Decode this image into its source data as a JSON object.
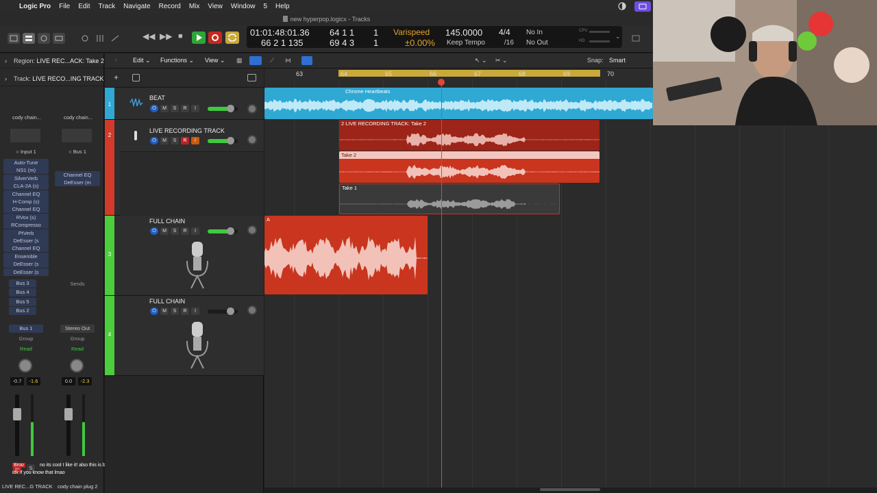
{
  "menubar": {
    "apple": "",
    "app_name": "Logic Pro",
    "items": [
      "File",
      "Edit",
      "Track",
      "Navigate",
      "Record",
      "Mix",
      "View",
      "Window",
      "5",
      "Help"
    ]
  },
  "window": {
    "title": "new hyperpop.logicx - Tracks"
  },
  "lcd": {
    "time": "01:01:48:01.36",
    "bars_top": "64  1  1",
    "sub_top": "1",
    "bars_bottom": "66  2  1  135",
    "bars_bottom2": "69  4  3",
    "sub_bottom": "1",
    "varispeed_label": "Varispeed",
    "varispeed_value": "±0.00%",
    "tempo": "145.0000",
    "tempo_mode": "Keep Tempo",
    "sig_top": "4/4",
    "sig_bottom": "/16",
    "in": "No In",
    "out": "No Out",
    "cpu": "CPU",
    "hd": "HD"
  },
  "inspector": {
    "region_label": "Region:",
    "region_value": "LIVE REC...ACK: Take 2",
    "track_label": "Track:",
    "track_value": "LIVE RECO...ING TRACK",
    "strip1": {
      "setting": "cody chain...",
      "input": "Input 1",
      "plugins": [
        "Auto-Tune",
        "NS1 (m)",
        "SilverVerb",
        "CLA-2A (s)",
        "Channel EQ",
        "H-Comp (s)",
        "Channel EQ",
        "RVox (s)",
        "RCompresso",
        "PtVerb",
        "DeEsser (s",
        "Channel EQ",
        "Ensemble",
        "DeEsser (s",
        "DeEsser (s"
      ],
      "sends": [
        "Bus 3",
        "Bus 4",
        "Bus 5",
        "Bus 2"
      ],
      "output": "Bus 1",
      "group": "Group",
      "automation": "Read",
      "vol": "-0.7",
      "peak": "-1.6",
      "name": "LIVE REC...G TRACK"
    },
    "strip2": {
      "setting": "cody chain...",
      "input": "Bus 1",
      "plugins": [
        "Channel EQ",
        "DeEsser (m"
      ],
      "sends_label": "Sends",
      "output": "Stereo Out",
      "group": "Group",
      "automation": "Read",
      "vol": "0.0",
      "peak": "-2.3",
      "name": "cody chain plug 2"
    }
  },
  "toolbar": {
    "edit": "Edit",
    "functions": "Functions",
    "view": "View",
    "snap_label": "Snap:",
    "snap_value": "Smart"
  },
  "tracks": [
    {
      "num": "1",
      "name": "BEAT",
      "color": "#2fa9d4"
    },
    {
      "num": "2",
      "name": "LIVE RECORDING TRACK",
      "color": "#d23a2a"
    },
    {
      "num": "3",
      "name": "FULL CHAIN",
      "color": "#4ccd3e"
    },
    {
      "num": "4",
      "name": "FULL CHAIN",
      "color": "#4ccd3e"
    }
  ],
  "track_buttons": {
    "mute": "M",
    "solo": "S",
    "record": "R",
    "input": "I"
  },
  "ruler": [
    "63",
    "64",
    "65",
    "66",
    "67",
    "68",
    "69",
    "70"
  ],
  "regions": {
    "beat": "Chrome Heartbeats",
    "comp": "2  LIVE RECORDING TRACK: Take 2",
    "take2": "Take 2",
    "take1": "Take 1",
    "full_chain": "A"
  },
  "subtitles": {
    "line1_user": "Broo",
    "line1": "no its cool I like it! also this is brooke from tik tok",
    "line2": "idk if you know that lmao",
    "m": "M",
    "s": "S"
  },
  "colors": {
    "accent_blue": "#2fa9d4",
    "recording_red": "#d23a2a",
    "cycle_yellow": "#c9a93a",
    "full_chain_green": "#4ccd3e"
  }
}
